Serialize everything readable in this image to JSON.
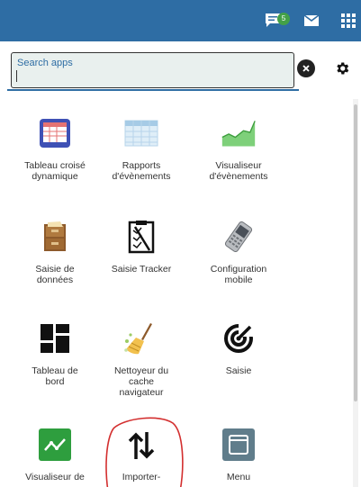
{
  "topbar": {
    "chat_icon": "chat-icon",
    "badge_count": "5",
    "mail_icon": "mail-icon",
    "apps_icon": "apps-grid-icon",
    "bg_color": "#2e6da4"
  },
  "search": {
    "placeholder": "Search apps",
    "value": "",
    "clear_icon": "clear-circle-icon",
    "settings_icon": "gear-icon"
  },
  "apps": [
    {
      "label": "Tableau croisé\ndynamique",
      "icon": "pivot-table-icon"
    },
    {
      "label": "Rapports\nd'évènements",
      "icon": "event-reports-icon"
    },
    {
      "label": "Visualiseur\nd'évènements",
      "icon": "event-visualizer-icon"
    },
    {
      "label": "Saisie de\ndonnées",
      "icon": "data-entry-icon"
    },
    {
      "label": "Saisie Tracker",
      "icon": "tracker-capture-icon"
    },
    {
      "label": "Configuration\nmobile",
      "icon": "mobile-config-icon"
    },
    {
      "label": "Tableau de\nbord",
      "icon": "dashboard-icon"
    },
    {
      "label": "Nettoyeur du\ncache\nnavigateur",
      "icon": "browser-cache-cleaner-icon"
    },
    {
      "label": "Saisie",
      "icon": "capture-icon"
    },
    {
      "label": "Visualiseur de",
      "icon": "data-visualizer-icon"
    },
    {
      "label": "Importer-",
      "icon": "import-export-icon"
    },
    {
      "label": "Menu",
      "icon": "menu-icon"
    }
  ],
  "annotation_color": "#d32f2f"
}
